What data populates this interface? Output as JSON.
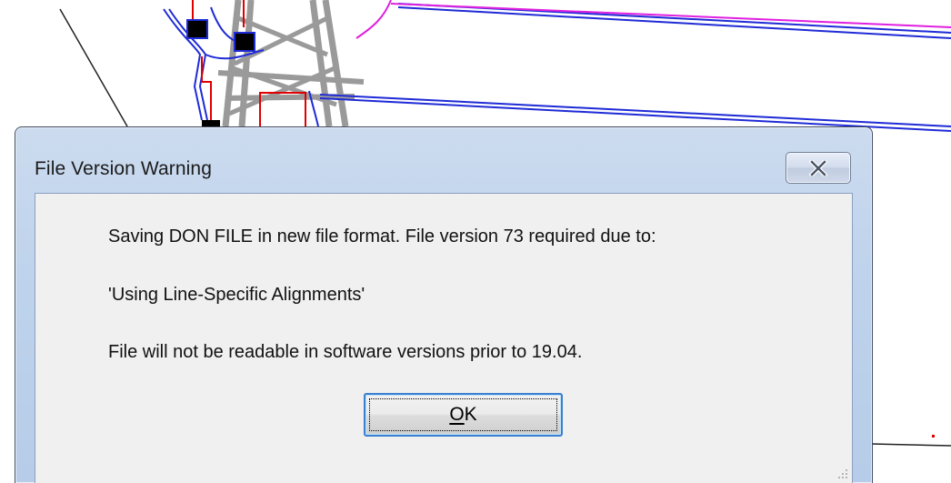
{
  "dialog": {
    "title": "File Version Warning",
    "message_line_1": "Saving DON FILE in new file format. File version 73 required due to:",
    "message_line_2": "'Using Line-Specific Alignments'",
    "message_line_3": "File will not be readable in software versions prior to 19.04.",
    "ok_button": {
      "mnemonic": "O",
      "rest": "K"
    }
  },
  "icons": {
    "close": "close-icon",
    "resize": "resize-grip-icon"
  },
  "colors": {
    "titlebar": "#bfd3ec",
    "client_bg": "#f0f0f0",
    "focus_border": "#3a7fd0",
    "drawing_blue": "#1f2bd6",
    "drawing_magenta": "#e020e0",
    "drawing_red": "#e00000"
  }
}
